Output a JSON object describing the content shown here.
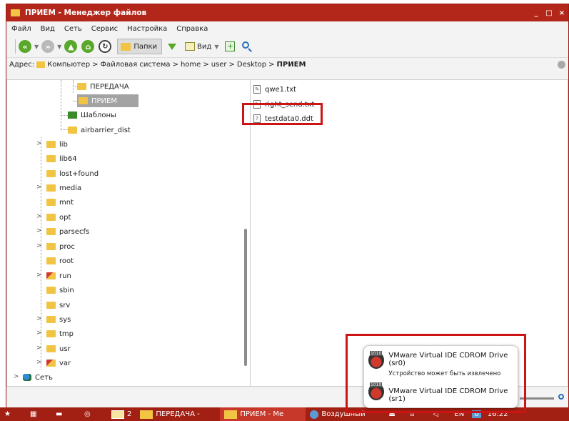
{
  "window": {
    "title": "ПРИЕМ - Менеджер файлов",
    "min_label": "_",
    "max_label": "□",
    "close_label": "×"
  },
  "menu": [
    "Файл",
    "Вид",
    "Сеть",
    "Сервис",
    "Настройка",
    "Справка"
  ],
  "toolbar": {
    "folders_label": "Папки",
    "view_label": "Вид",
    "add_label": "+"
  },
  "address": {
    "label": "Адрес:",
    "crumbs": [
      "Компьютер",
      "Файловая система",
      "home",
      "user",
      "Desktop"
    ],
    "current": "ПРИЕМ",
    "sep": ">"
  },
  "tree": {
    "items": [
      {
        "label": "ПЕРЕДАЧА",
        "icon": "folder"
      },
      {
        "label": "ПРИЕМ",
        "icon": "folder",
        "selected": true
      },
      {
        "label": "Шаблоны",
        "icon": "folder-green"
      },
      {
        "label": "airbarrier_dist",
        "icon": "folder"
      },
      {
        "label": "lib",
        "icon": "folder",
        "expandable": true
      },
      {
        "label": "lib64",
        "icon": "folder"
      },
      {
        "label": "lost+found",
        "icon": "folder"
      },
      {
        "label": "media",
        "icon": "folder",
        "expandable": true
      },
      {
        "label": "mnt",
        "icon": "folder"
      },
      {
        "label": "opt",
        "icon": "folder",
        "expandable": true
      },
      {
        "label": "parsecfs",
        "icon": "folder",
        "expandable": true
      },
      {
        "label": "proc",
        "icon": "folder",
        "expandable": true
      },
      {
        "label": "root",
        "icon": "folder"
      },
      {
        "label": "run",
        "icon": "folder-red",
        "expandable": true
      },
      {
        "label": "sbin",
        "icon": "folder"
      },
      {
        "label": "srv",
        "icon": "folder"
      },
      {
        "label": "sys",
        "icon": "folder",
        "expandable": true
      },
      {
        "label": "tmp",
        "icon": "folder",
        "expandable": true
      },
      {
        "label": "usr",
        "icon": "folder",
        "expandable": true
      },
      {
        "label": "var",
        "icon": "folder-red",
        "expandable": true
      },
      {
        "label": "Сеть",
        "icon": "network",
        "expandable": true
      }
    ]
  },
  "files": [
    {
      "name": "qwe1.txt",
      "icon": "edit-doc"
    },
    {
      "name": "right_send.txt",
      "icon": "edit-doc"
    },
    {
      "name": "testdata0.ddt",
      "icon": "unknown-doc",
      "highlighted": true
    }
  ],
  "notifications": [
    {
      "disk_label": "1010",
      "title": "VMware Virtual IDE CDROM Drive (sr0)",
      "subtitle": "Устройство может быть извлечено"
    },
    {
      "disk_label": "1010",
      "title": "VMware Virtual IDE CDROM Drive (sr1)"
    }
  ],
  "taskbar": {
    "items": [
      {
        "label": "2"
      },
      {
        "label": "ПЕРЕДАЧА -"
      },
      {
        "label": "ПРИЕМ - Ме",
        "active": true
      },
      {
        "label": "Воздушный"
      }
    ],
    "lang": "EN",
    "badge": "0",
    "clock": "16:22"
  },
  "colors": {
    "titlebar": "#b3271b",
    "taskbar": "#a21f13",
    "folder": "#f2c443",
    "highlight": "#cc1414"
  }
}
